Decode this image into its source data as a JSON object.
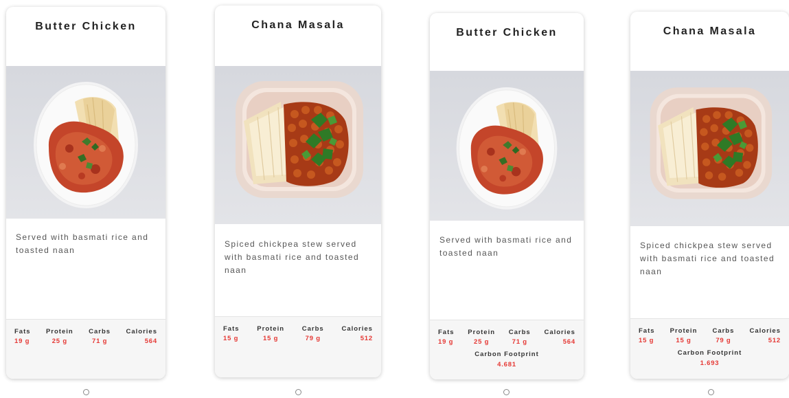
{
  "cards": [
    {
      "title": "Butter Chicken",
      "description": "Served with basmati rice and toasted naan",
      "nutrition": {
        "labels": [
          "Fats",
          "Protein",
          "Carbs",
          "Calories"
        ],
        "values": [
          "19 g",
          "25 g",
          "71 g",
          "564"
        ]
      }
    },
    {
      "title": "Chana Masala",
      "description": "Spiced chickpea stew served with basmati rice and toasted naan",
      "nutrition": {
        "labels": [
          "Fats",
          "Protein",
          "Carbs",
          "Calories"
        ],
        "values": [
          "15 g",
          "15 g",
          "79 g",
          "512"
        ]
      }
    },
    {
      "title": "Butter Chicken",
      "description": "Served with basmati rice and toasted naan",
      "nutrition": {
        "labels": [
          "Fats",
          "Protein",
          "Carbs",
          "Calories"
        ],
        "values": [
          "19 g",
          "25 g",
          "71 g",
          "564"
        ]
      },
      "footprint": {
        "label": "Carbon Footprint",
        "value": "4.681"
      }
    },
    {
      "title": "Chana Masala",
      "description": "Spiced chickpea stew served with basmati rice and toasted naan",
      "nutrition": {
        "labels": [
          "Fats",
          "Protein",
          "Carbs",
          "Calories"
        ],
        "values": [
          "15 g",
          "15 g",
          "79 g",
          "512"
        ]
      },
      "footprint": {
        "label": "Carbon Footprint",
        "value": "1.693"
      }
    }
  ],
  "colors": {
    "accent_red": "#e53935",
    "image_bg": "#d9dbe0",
    "footer_bg": "#f6f6f6"
  },
  "icons": {
    "indicator": "radio-circle-icon",
    "butter_chicken_image": "butter-chicken-plate-image",
    "chana_masala_image": "chana-masala-bowl-image"
  }
}
